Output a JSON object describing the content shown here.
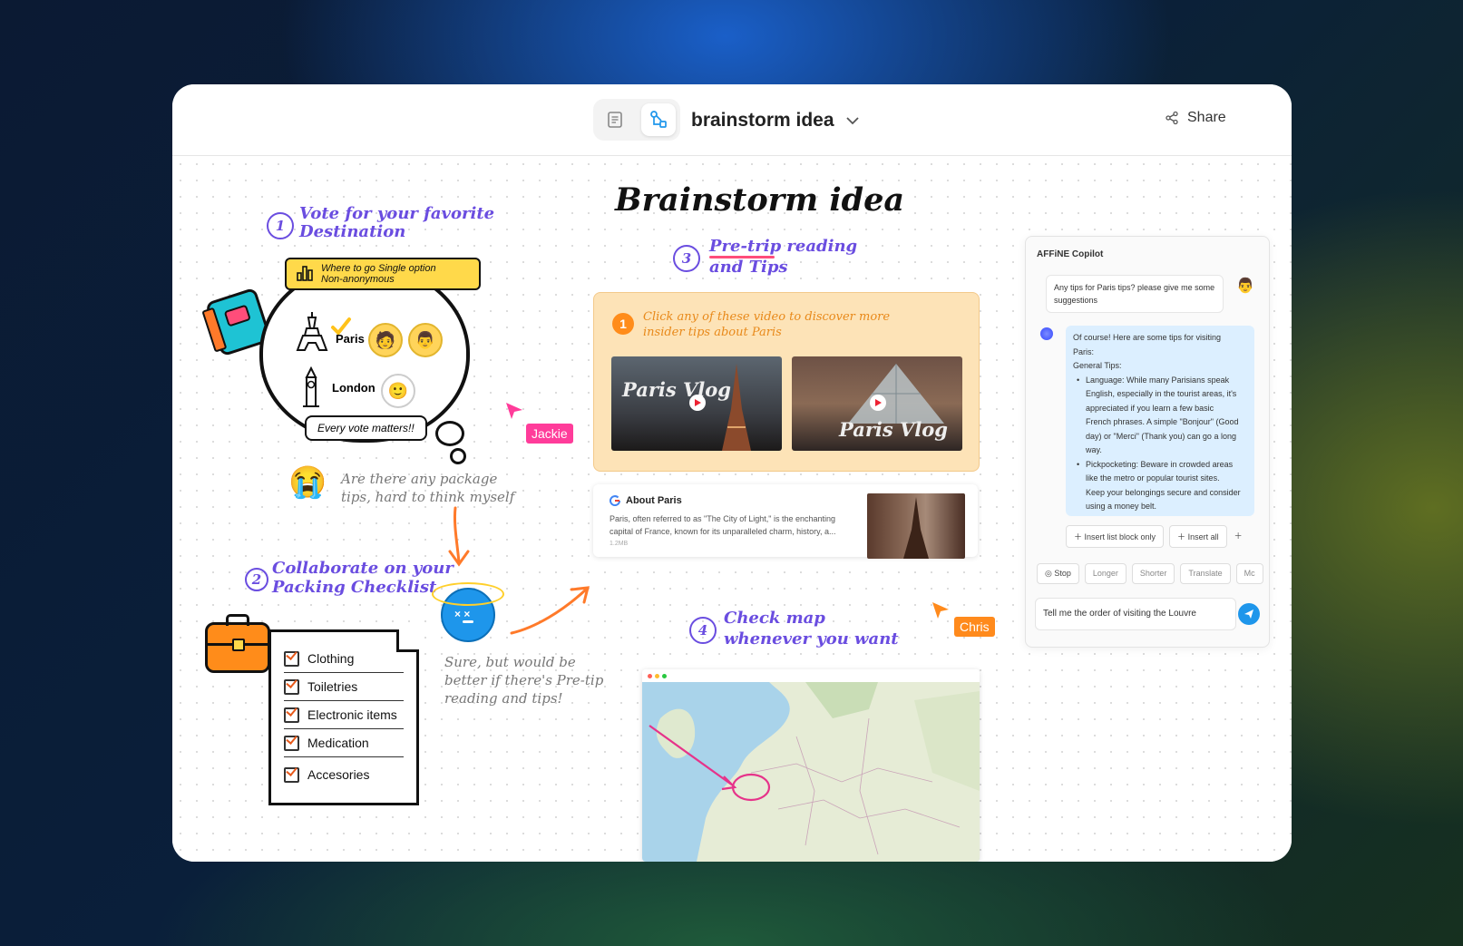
{
  "header": {
    "doc_title": "brainstorm idea",
    "share_label": "Share"
  },
  "board": {
    "title": "Brainstorm idea",
    "section1": {
      "number": "1",
      "title_line1": "Vote for your favorite",
      "title_line2": "Destination",
      "poll_line1": "Where to go Single option",
      "poll_line2": "Non-anonymous",
      "options": [
        {
          "label": "Paris"
        },
        {
          "label": "London"
        }
      ],
      "footer": "Every vote matters!!"
    },
    "note1": {
      "line1": "Are there any package",
      "line2": "tips, hard to think myself"
    },
    "section2": {
      "number": "2",
      "title_line1": "Collaborate on your",
      "title_line2": "Packing Checklist",
      "items": [
        "Clothing",
        "Toiletries",
        "Electronic items",
        "Medication",
        "Accesories"
      ]
    },
    "note2": {
      "line1": "Sure, but would be",
      "line2": "better if there's Pre-tip",
      "line3": "reading and tips!"
    },
    "section3": {
      "number": "3",
      "title_line1": "Pre-trip reading",
      "title_line2": "and Tips",
      "video_card": {
        "badge": "1",
        "line1": "Click any of these video to discover more",
        "line2": "insider tips about Paris",
        "videos": [
          {
            "label": "Paris Vlog"
          },
          {
            "label": "Paris Vlog"
          }
        ]
      },
      "link_card": {
        "title": "About Paris",
        "line1": "Paris, often referred to as \"The City of Light,\" is the enchanting",
        "line2": "capital of France, known for its unparalleled charm, history, a...",
        "size": "1.2MB"
      }
    },
    "section4": {
      "number": "4",
      "title_line1": "Check map",
      "title_line2": "whenever you want"
    },
    "cursors": [
      {
        "name": "Jackie",
        "color": "#ff3c9a"
      },
      {
        "name": "Chris",
        "color": "#ff8a1c"
      }
    ]
  },
  "copilot": {
    "title": "AFFiNE Copilot",
    "user_msg_line1": "Any tips for Paris tips? please give me some",
    "user_msg_line2": "suggestions",
    "reply": {
      "l1": "Of course! Here are some tips for visiting",
      "l2": "Paris:",
      "l3": "General Tips:",
      "b1": [
        "Language: While many Parisians speak",
        "English, especially in the tourist areas, it's",
        "appreciated if you learn a few basic",
        "French phrases. A simple \"Bonjour\" (Good",
        "day) or \"Merci\" (Thank you) can go a long",
        "way."
      ],
      "b2": [
        "Pickpocketing: Beware in crowded areas",
        "like the metro or popular tourist sites.",
        "Keep your belongings secure and consider",
        "using a money belt."
      ]
    },
    "actions": {
      "insert_list": "Insert list block only",
      "insert_all": "Insert all"
    },
    "chips": {
      "stop": "Stop",
      "longer": "Longer",
      "shorter": "Shorter",
      "translate": "Translate",
      "more": "Mc"
    },
    "input_value": "Tell me the order of visiting the Louvre"
  },
  "colors": {
    "accent": "#6a4de0",
    "send": "#1e96eb",
    "copilot_reply_bg": "#dcefff"
  }
}
